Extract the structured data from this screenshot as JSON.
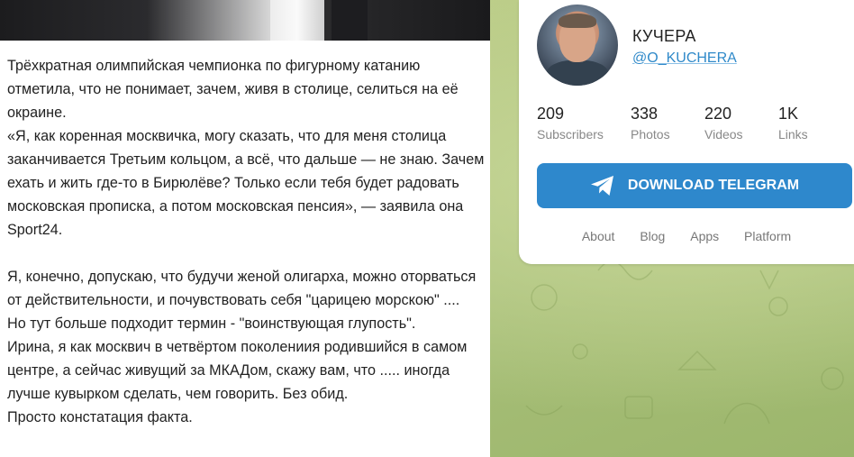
{
  "post": {
    "paragraphs": [
      "Трёхкратная олимпийская чемпионка по фигурному катанию отметила, что не понимает, зачем, живя в столице, селиться на её окраине.",
      "«Я, как коренная москвичка, могу сказать, что для меня столица заканчивается Третьим кольцом, а всё, что дальше — не знаю. Зачем ехать и жить где-то в Бирюлёве? Только если тебя будет радовать московская прописка, а потом московская пенсия», — заявила она Sport24.",
      "Я, конечно, допускаю, что будучи женой олигарха, можно оторваться от действительности, и почувствовать себя \"царицею морскою\" ....",
      "Но тут больше подходит термин - \"воинствующая глупость\".",
      "Ирина, я как москвич в четвёртом поколениия родившийся в самом центре, а сейчас живущий за МКАДом, скажу вам, что ..... иногда лучше кувырком сделать, чем говорить. Без обид.",
      "Просто констатация факта."
    ]
  },
  "channel": {
    "name": "КУЧЕРА",
    "handle": "@O_KUCHERA",
    "stats": [
      {
        "value": "209",
        "label": "Subscribers"
      },
      {
        "value": "338",
        "label": "Photos"
      },
      {
        "value": "220",
        "label": "Videos"
      },
      {
        "value": "1K",
        "label": "Links"
      }
    ],
    "download_label": "DOWNLOAD TELEGRAM",
    "footer_links": [
      "About",
      "Blog",
      "Apps",
      "Platform"
    ]
  },
  "colors": {
    "accent": "#2e88cc",
    "link": "#2f89c9",
    "background": "#b5c98a"
  }
}
